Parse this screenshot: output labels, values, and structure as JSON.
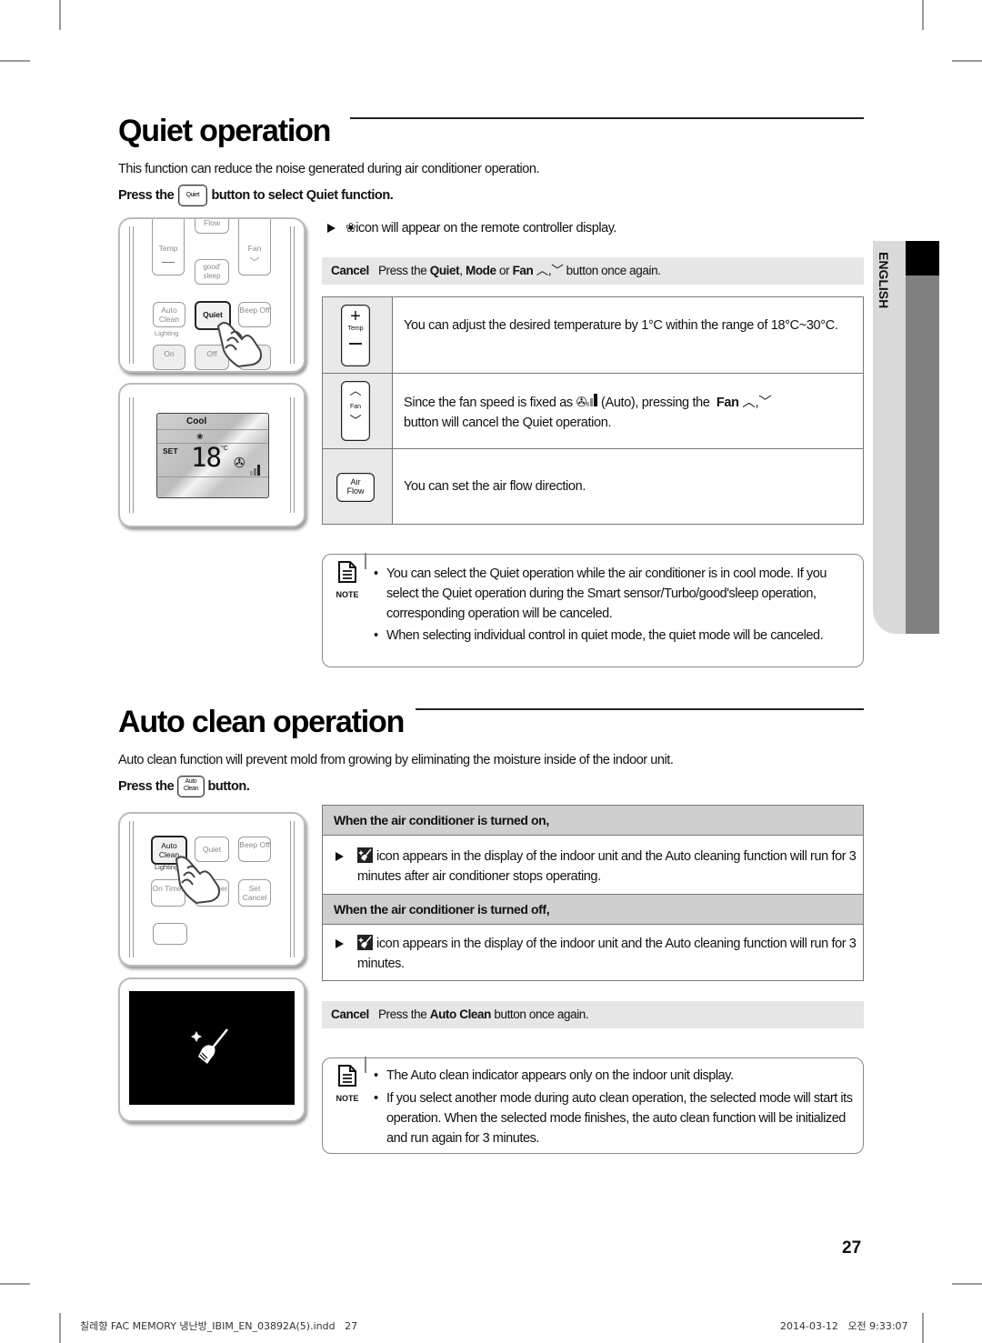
{
  "quiet": {
    "title": "Quiet operation",
    "intro": "This function can reduce the noise generated during air conditioner operation.",
    "press_prefix": "Press the",
    "press_button": "Quiet",
    "press_suffix": "button to select Quiet function.",
    "icon_note": "icon will appear on the remote controller display.",
    "cancel": {
      "label": "Cancel",
      "text_1": "Press the",
      "b1": "Quiet",
      "sep1": ",",
      "b2": "Mode",
      "text_2": "or",
      "b3": "Fan",
      "text_3": "button once again."
    },
    "table": [
      {
        "key": "Temp",
        "text": "You can adjust the desired temperature by 1°C within the range of 18°C~30°C."
      },
      {
        "key": "Fan",
        "text_1": "Since the fan speed is fixed as",
        "text_2": "(Auto), pressing the",
        "bold": "Fan",
        "text_3": "button will cancel the Quiet operation."
      },
      {
        "key_line1": "Air",
        "key_line2": "Flow",
        "text": "You can set the air flow direction."
      }
    ],
    "notes": [
      "You can select the Quiet operation while the air conditioner is in cool mode. If you select the Quiet operation during the Smart sensor/Turbo/good'sleep operation, corresponding operation will be canceled.",
      "When selecting individual control in quiet mode, the quiet mode will be canceled."
    ],
    "remote": {
      "buttons": [
        "Temp",
        "Fan",
        "good' sleep",
        "Auto Clean",
        "Quiet",
        "Beep Off",
        "On",
        "Off",
        "Flow"
      ],
      "lighting": "Lighting"
    },
    "display": {
      "mode": "Cool",
      "set": "SET",
      "temp": "18",
      "unit": "°C"
    }
  },
  "auto_clean": {
    "title": "Auto clean operation",
    "intro": "Auto clean function will prevent mold from growing by eliminating the moisture inside of the indoor unit.",
    "press_prefix": "Press the",
    "press_button_l1": "Auto",
    "press_button_l2": "Clean",
    "press_suffix": "button.",
    "on_head": "When the air conditioner is turned on,",
    "on_body": "icon appears in the display of the indoor unit and the Auto cleaning function will run for 3 minutes after air conditioner stops operating.",
    "off_head": "When the air conditioner is turned off,",
    "off_body": "icon appears in the display of the indoor unit and the Auto cleaning function will run for 3 minutes.",
    "cancel": {
      "label": "Cancel",
      "text_1": "Press the",
      "b1": "Auto Clean",
      "text_2": "button once again."
    },
    "notes": [
      "The Auto clean indicator appears only on the indoor unit display.",
      "If you select another mode during auto clean operation, the selected mode will start its operation. When the selected mode finishes, the auto clean function will be initialized and run again for 3 minutes."
    ],
    "remote": {
      "buttons": [
        "Auto Clean",
        "Quiet",
        "Beep Off",
        "On Timer",
        "Off Timer",
        "Set Cancel"
      ],
      "lighting": "Lighting"
    }
  },
  "note_label": "NOTE",
  "side_tab": "ENGLISH",
  "page_number": "27",
  "footer": {
    "file": "칠레향 FAC MEMORY 냉난방_IBIM_EN_03892A(5).indd   27",
    "timestamp": "2014-03-12   오전 9:33:07"
  }
}
